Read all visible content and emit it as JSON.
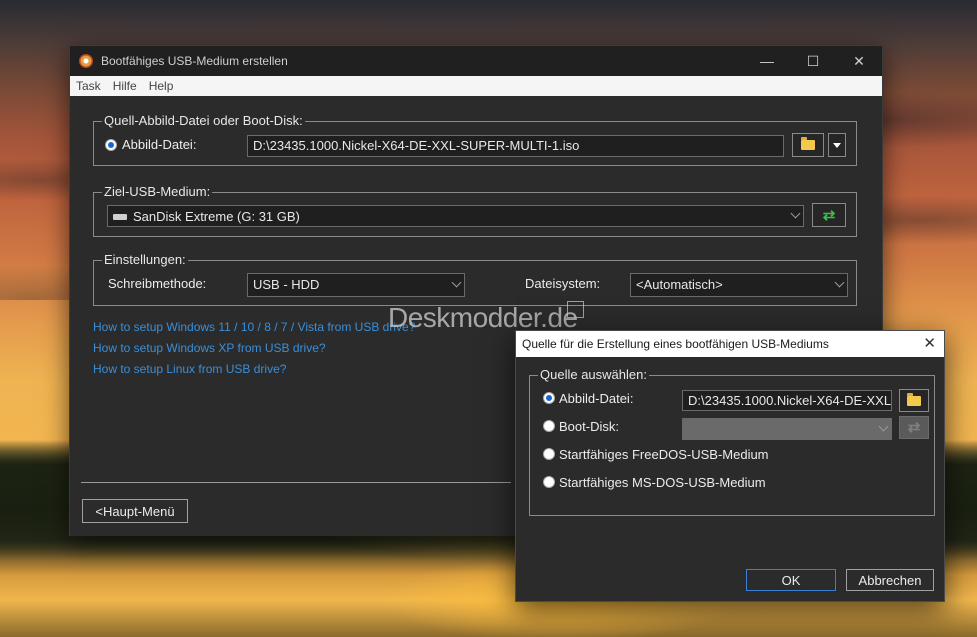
{
  "main_window": {
    "title": "Bootfähiges USB-Medium erstellen",
    "controls": {
      "minimize": "—",
      "maximize": "☐",
      "close": "✕"
    },
    "menu": [
      "Task",
      "Hilfe",
      "Help"
    ],
    "source_group": {
      "label": "Quell-Abbild-Datei oder Boot-Disk:",
      "radio_label": "Abbild-Datei:",
      "path_value": "D:\\23435.1000.Nickel-X64-DE-XXL-SUPER-MULTI-1.iso"
    },
    "target_group": {
      "label": "Ziel-USB-Medium:",
      "drive_value": "SanDisk Extreme (G:  31 GB)"
    },
    "settings_group": {
      "label": "Einstellungen:",
      "write_method_label": "Schreibmethode:",
      "write_method_value": "USB - HDD",
      "filesystem_label": "Dateisystem:",
      "filesystem_value": "<Automatisch>"
    },
    "links": [
      "How to setup Windows 11 / 10 / 8 / 7 / Vista from USB drive?",
      "How to setup Windows XP from USB drive?",
      "How to setup Linux from USB drive?"
    ],
    "main_menu_button": "<Haupt-Menü"
  },
  "watermark": "Deskmodder.de",
  "dialog": {
    "title": "Quelle für die Erstellung eines bootfähigen USB-Mediums",
    "close": "✕",
    "group_label": "Quelle auswählen:",
    "options": [
      {
        "label": "Abbild-Datei:",
        "selected": true
      },
      {
        "label": "Boot-Disk:",
        "selected": false
      },
      {
        "label": "Startfähiges FreeDOS-USB-Medium",
        "selected": false
      },
      {
        "label": "Startfähiges MS-DOS-USB-Medium",
        "selected": false
      }
    ],
    "image_path_value": "D:\\23435.1000.Nickel-X64-DE-XXL-",
    "ok_button": "OK",
    "cancel_button": "Abbrechen"
  },
  "icons": [
    "app-icon",
    "folder-icon",
    "dropdown-arrow-icon",
    "refresh-icon",
    "usb-drive-icon",
    "chevron-down-icon"
  ],
  "colors": {
    "link": "#3a8fd9",
    "radio_selected": "#1a66d0",
    "refresh": "#3cbf4a",
    "folder": "#f2c94c"
  }
}
